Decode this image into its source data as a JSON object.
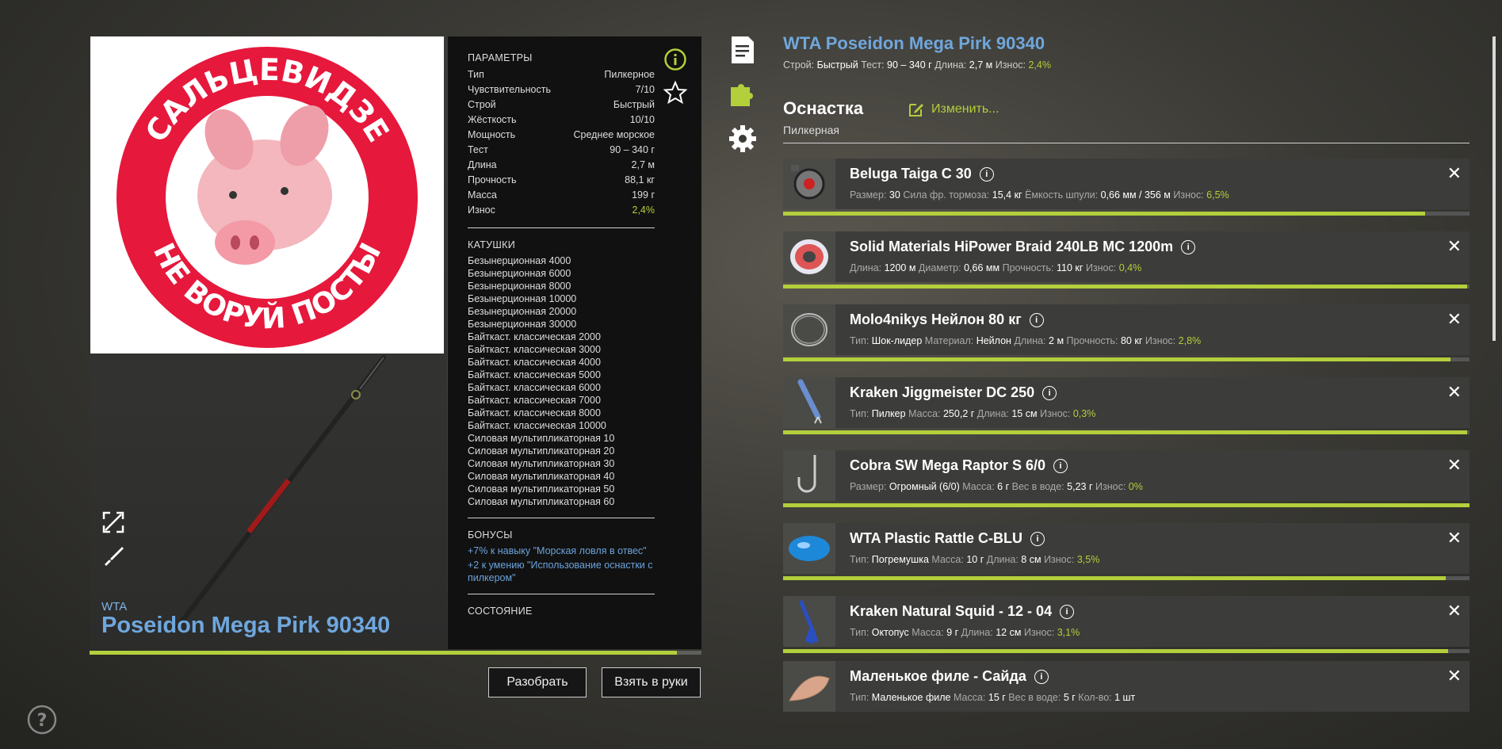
{
  "rod": {
    "brand": "WTA",
    "name": "Poseidon Mega Pirk 90340",
    "wear_fraction": 0.96
  },
  "logo": {
    "top_text": "САЛЬЦЕВИДЗЕ",
    "bottom_text": "НЕ ВОРУЙ ПОСТЫ"
  },
  "params": {
    "title": "ПАРАМЕТРЫ",
    "rows": [
      {
        "k": "Тип",
        "v": "Пилкерное"
      },
      {
        "k": "Чувствительность",
        "v": "7/10"
      },
      {
        "k": "Строй",
        "v": "Быстрый"
      },
      {
        "k": "Жёсткость",
        "v": "10/10"
      },
      {
        "k": "Мощность",
        "v": "Среднее морское"
      },
      {
        "k": "Тест",
        "v": "90 – 340 г"
      },
      {
        "k": "Длина",
        "v": "2,7 м"
      },
      {
        "k": "Прочность",
        "v": "88,1 кг"
      },
      {
        "k": "Масса",
        "v": "199 г"
      },
      {
        "k": "Износ",
        "v": "2,4%"
      }
    ],
    "reels_title": "КАТУШКИ",
    "reels": [
      "Безынерционная 4000",
      "Безынерционная 6000",
      "Безынерционная 8000",
      "Безынерционная 10000",
      "Безынерционная 20000",
      "Безынерционная 30000",
      "Байткаст. классическая 2000",
      "Байткаст. классическая 3000",
      "Байткаст. классическая 4000",
      "Байткаст. классическая 5000",
      "Байткаст. классическая 6000",
      "Байткаст. классическая 7000",
      "Байткаст. классическая 8000",
      "Байткаст. классическая 10000",
      "Силовая мультипликаторная 10",
      "Силовая мультипликаторная 20",
      "Силовая мультипликаторная 30",
      "Силовая мультипликаторная 40",
      "Силовая мультипликаторная 50",
      "Силовая мультипликаторная 60"
    ],
    "bonuses_title": "БОНУСЫ",
    "bonuses": [
      "+7% к навыку \"Морская ловля в отвес\"",
      "+2 к умению \"Использование оснастки с пилкером\""
    ],
    "state_title": "СОСТОЯНИЕ"
  },
  "buttons": {
    "disassemble": "Разобрать",
    "take": "Взять в руки"
  },
  "header": {
    "title": "WTA Poseidon Mega Pirk 90340",
    "sub": [
      {
        "k": "Строй:",
        "v": "Быстрый"
      },
      {
        "k": "Тест:",
        "v": "90 – 340 г"
      },
      {
        "k": "Длина:",
        "v": "2,7 м"
      },
      {
        "k": "Износ:",
        "v": "2,4%",
        "green": true
      }
    ]
  },
  "tackle": {
    "title": "Оснастка",
    "type": "Пилкерная",
    "edit_label": "Изменить..."
  },
  "items": [
    {
      "name": "Beluga Taiga C 30",
      "icon": "reel-icon",
      "wear": 0.935,
      "props": [
        {
          "k": "Размер:",
          "v": "30"
        },
        {
          "k": "Сила фр. тормоза:",
          "v": "15,4 кг"
        },
        {
          "k": "Ёмкость шпули:",
          "v": "0,66 мм / 356 м"
        },
        {
          "k": "Износ:",
          "v": "6,5%",
          "g": true
        }
      ]
    },
    {
      "name": "Solid Materials HiPower Braid 240LB MC 1200m",
      "icon": "line-spool-icon",
      "wear": 0.996,
      "props": [
        {
          "k": "Длина:",
          "v": "1200 м"
        },
        {
          "k": "Диаметр:",
          "v": "0,66 мм"
        },
        {
          "k": "Прочность:",
          "v": "110 кг"
        },
        {
          "k": "Износ:",
          "v": "0,4%",
          "g": true
        }
      ]
    },
    {
      "name": "Molo4nikys Нейлон 80 кг",
      "icon": "leader-coil-icon",
      "wear": 0.972,
      "props": [
        {
          "k": "Тип:",
          "v": "Шок-лидер"
        },
        {
          "k": "Материал:",
          "v": "Нейлон"
        },
        {
          "k": "Длина:",
          "v": "2 м"
        },
        {
          "k": "Прочность:",
          "v": "80 кг"
        },
        {
          "k": "Износ:",
          "v": "2,8%",
          "g": true
        }
      ]
    },
    {
      "name": "Kraken Jiggmeister DC 250",
      "icon": "pilker-icon",
      "wear": 0.997,
      "props": [
        {
          "k": "Тип:",
          "v": "Пилкер"
        },
        {
          "k": "Масса:",
          "v": "250,2 г"
        },
        {
          "k": "Длина:",
          "v": "15 см"
        },
        {
          "k": "Износ:",
          "v": "0,3%",
          "g": true
        }
      ]
    },
    {
      "name": "Cobra SW Mega Raptor S 6/0",
      "icon": "hook-icon",
      "wear": 1.0,
      "props": [
        {
          "k": "Размер:",
          "v": "Огромный (6/0)"
        },
        {
          "k": "Масса:",
          "v": "6 г"
        },
        {
          "k": "Вес в воде:",
          "v": "5,23 г"
        },
        {
          "k": "Износ:",
          "v": "0%",
          "g": true
        }
      ]
    },
    {
      "name": "WTA Plastic Rattle C-BLU",
      "icon": "rattle-icon",
      "wear": 0.965,
      "props": [
        {
          "k": "Тип:",
          "v": "Погремушка"
        },
        {
          "k": "Масса:",
          "v": "10 г"
        },
        {
          "k": "Длина:",
          "v": "8 см"
        },
        {
          "k": "Износ:",
          "v": "3,5%",
          "g": true
        }
      ]
    },
    {
      "name": "Kraken Natural Squid - 12 - 04",
      "icon": "squid-icon",
      "wear": 0.969,
      "props": [
        {
          "k": "Тип:",
          "v": "Октопус"
        },
        {
          "k": "Масса:",
          "v": "9 г"
        },
        {
          "k": "Длина:",
          "v": "12 см"
        },
        {
          "k": "Износ:",
          "v": "3,1%",
          "g": true
        }
      ]
    },
    {
      "name": "Маленькое филе - Сайда",
      "icon": "fillet-icon",
      "wear": null,
      "props": [
        {
          "k": "Тип:",
          "v": "Маленькое филе"
        },
        {
          "k": "Масса:",
          "v": "15 г"
        },
        {
          "k": "Вес в воде:",
          "v": "5 г"
        },
        {
          "k": "Кол-во:",
          "v": "1 шт"
        }
      ]
    }
  ],
  "colors": {
    "accent": "#b3cf3c",
    "link": "#6fa7dd"
  }
}
